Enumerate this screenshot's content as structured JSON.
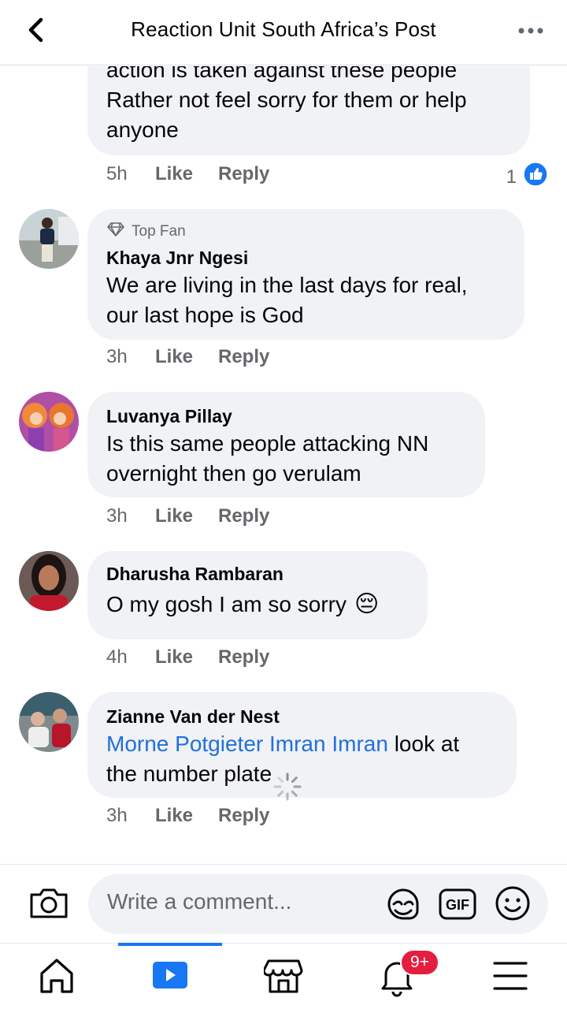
{
  "header": {
    "title": "Reaction Unit South Africa’s Post"
  },
  "comments": [
    {
      "lines": [
        "action is taken against these people",
        "Rather not feel sorry for them or help",
        "anyone"
      ],
      "time": "5h",
      "like": "Like",
      "reply": "Reply",
      "reaction_count": "1"
    },
    {
      "badge": "Top Fan",
      "author": "Khaya Jnr Ngesi",
      "lines": [
        "We are living in the last days for real,",
        "our last hope is God"
      ],
      "time": "3h",
      "like": "Like",
      "reply": "Reply"
    },
    {
      "author": "Luvanya Pillay",
      "lines": [
        "Is this same people attacking NN",
        "overnight then go verulam"
      ],
      "time": "3h",
      "like": "Like",
      "reply": "Reply"
    },
    {
      "author": "Dharusha Rambaran",
      "lines": [
        "O my gosh I am so sorry",
        "😔"
      ],
      "time": "4h",
      "like": "Like",
      "reply": "Reply"
    },
    {
      "author": "Zianne Van der Nest",
      "mention": "Morne Potgieter Imran Imran",
      "lines": [
        " look at",
        "the number plate"
      ],
      "time": "3h",
      "like": "Like",
      "reply": "Reply"
    }
  ],
  "composer": {
    "placeholder": "Write a comment..."
  },
  "tabbar": {
    "notification_badge": "9+"
  },
  "colors": {
    "accent": "#1877f2",
    "mention": "#216fdb",
    "bubble": "#f0f2f5",
    "badge": "#e41e3f"
  },
  "icons": [
    "back-arrow-icon",
    "more-dots-icon",
    "like-thumb-icon",
    "diamond-icon",
    "camera-icon",
    "sticker-icon",
    "gif-icon",
    "emoji-icon",
    "home-icon",
    "video-icon",
    "marketplace-icon",
    "bell-icon",
    "menu-icon",
    "loading-spinner-icon"
  ]
}
